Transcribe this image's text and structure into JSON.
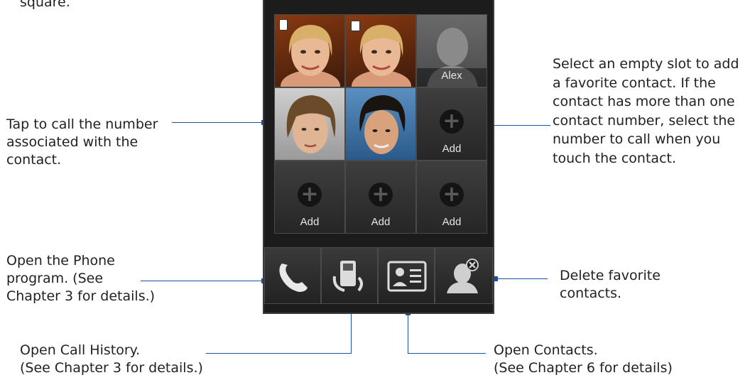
{
  "callouts": {
    "top_left_tail": "square.",
    "tap_to_call": [
      "Tap to call the number",
      "associated with the",
      "contact."
    ],
    "select_empty": [
      "Select an empty slot to add",
      "a favorite contact. If the",
      "contact has more than one",
      "contact number, select the",
      "number to call when you",
      "touch the contact."
    ],
    "open_phone": [
      "Open the Phone",
      "program. (See",
      "Chapter 3 for details.)"
    ],
    "delete_fav": [
      "Delete favorite",
      "contacts."
    ],
    "call_history": [
      "Open Call History.",
      "(See Chapter 3 for details.)"
    ],
    "open_contacts": [
      "Open Contacts.",
      "(See Chapter 6 for details)"
    ]
  },
  "grid": {
    "alex_label": "Alex",
    "add_label": "Add"
  },
  "toolbar": {
    "icons": [
      "phone-icon",
      "call-history-icon",
      "contact-card-icon",
      "delete-contact-icon"
    ]
  },
  "colors": {
    "accent": "#1f4fa0",
    "screen_bg": "#1c1c1c",
    "tile_bg": "#333333"
  }
}
